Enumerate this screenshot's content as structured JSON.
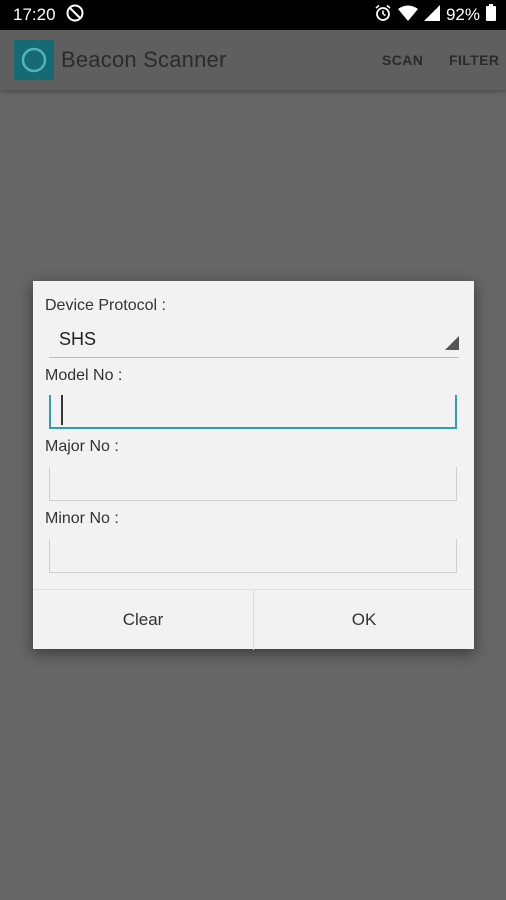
{
  "status_bar": {
    "time": "17:20",
    "battery": "92%",
    "icons": [
      "do-not-disturb-icon",
      "alarm-icon",
      "wifi-icon",
      "signal-icon",
      "battery-icon"
    ]
  },
  "app_bar": {
    "title": "Beacon Scanner",
    "actions": {
      "scan": "SCAN",
      "filter": "FILTER"
    }
  },
  "dialog": {
    "protocol_label": "Device Protocol :",
    "protocol_value": "SHS",
    "model_label": "Model No :",
    "model_value": "",
    "major_label": "Major No :",
    "major_value": "",
    "minor_label": "Minor No :",
    "minor_value": "",
    "clear_label": "Clear",
    "ok_label": "OK"
  },
  "colors": {
    "accent": "#2f9fb0",
    "app_icon": "#166a74",
    "scrim": "#666666",
    "dialog_bg": "#f2f2f2"
  }
}
